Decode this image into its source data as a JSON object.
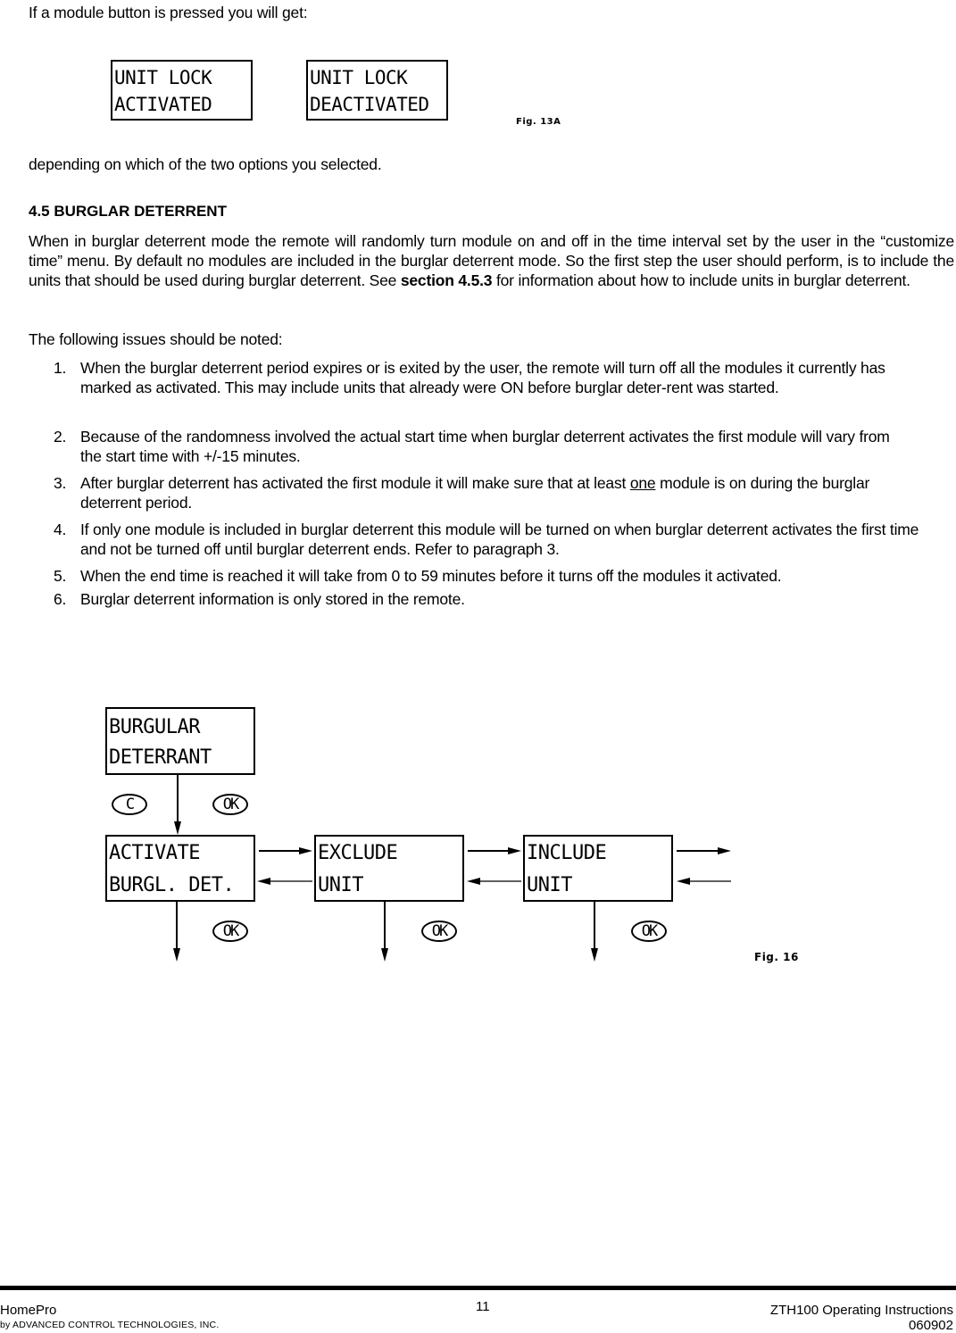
{
  "intro": "If a module button is pressed you will get:",
  "fig13a": {
    "boxes": [
      {
        "line1": "UNIT LOCK",
        "line2": "ACTIVATED"
      },
      {
        "line1": "UNIT LOCK",
        "line2": "DEACTIVATED"
      }
    ],
    "label": "Fig. 13A"
  },
  "after_fig": "depending on which of the two options you selected.",
  "section": {
    "heading": "4.5  BURGLAR  DETERRENT",
    "para1_a": "When in burglar deterrent mode the remote will randomly turn module on and off in the time interval set by the user in the “customize time” menu. By default no modules are included in the burglar deterrent mode. So the first step the user should perform, is to include the units that should be used during burglar deterrent. See ",
    "para1_bold": "section 4.5.3",
    "para1_b": " for information about how to include units in burglar deterrent.",
    "para2": "The following issues should be noted:",
    "items": [
      {
        "num": "1.",
        "text": "When the burglar deterrent period expires or is exited by the user, the remote will turn off all the modules it currently has marked as activated. This may include units that already were ON before burglar deter-rent was started."
      },
      {
        "num": "2.",
        "text": "Because of the randomness involved the actual start time when burglar deterrent activates the first module will vary from the start time with +/-15 minutes."
      },
      {
        "num": "3.",
        "text_a": "After burglar deterrent has activated the first module it will make sure that at least ",
        "text_u": "one",
        "text_b": " module is on during the burglar deterrent period."
      },
      {
        "num": "4.",
        "text": "If only one module is included in burglar deterrent this module will be turned on when burglar deterrent activates the first time and not be turned off until burglar deterrent ends. Refer to paragraph 3."
      },
      {
        "num": "5.",
        "text": "When the end time is reached it will take from 0 to 59 minutes before it turns off the modules it activated."
      },
      {
        "num": "6.",
        "text": "Burglar deterrent information is only stored in the remote."
      }
    ]
  },
  "fig16": {
    "top_box": {
      "line1": "BURGULAR",
      "line2": "DETERRANT"
    },
    "boxes": [
      {
        "line1": "ACTIVATE",
        "line2": "BURGL. DET."
      },
      {
        "line1": "EXCLUDE",
        "line2": "UNIT"
      },
      {
        "line1": "INCLUDE",
        "line2": "UNIT"
      }
    ],
    "buttons": {
      "c": "C",
      "ok": "OK"
    },
    "label": "Fig. 16"
  },
  "footer": {
    "brand": "HomePro",
    "company": "by ADVANCED CONTROL TECHNOLOGIES, INC.",
    "page": "11",
    "doc_title": "ZTH100 Operating Instructions",
    "doc_code": "060902"
  }
}
